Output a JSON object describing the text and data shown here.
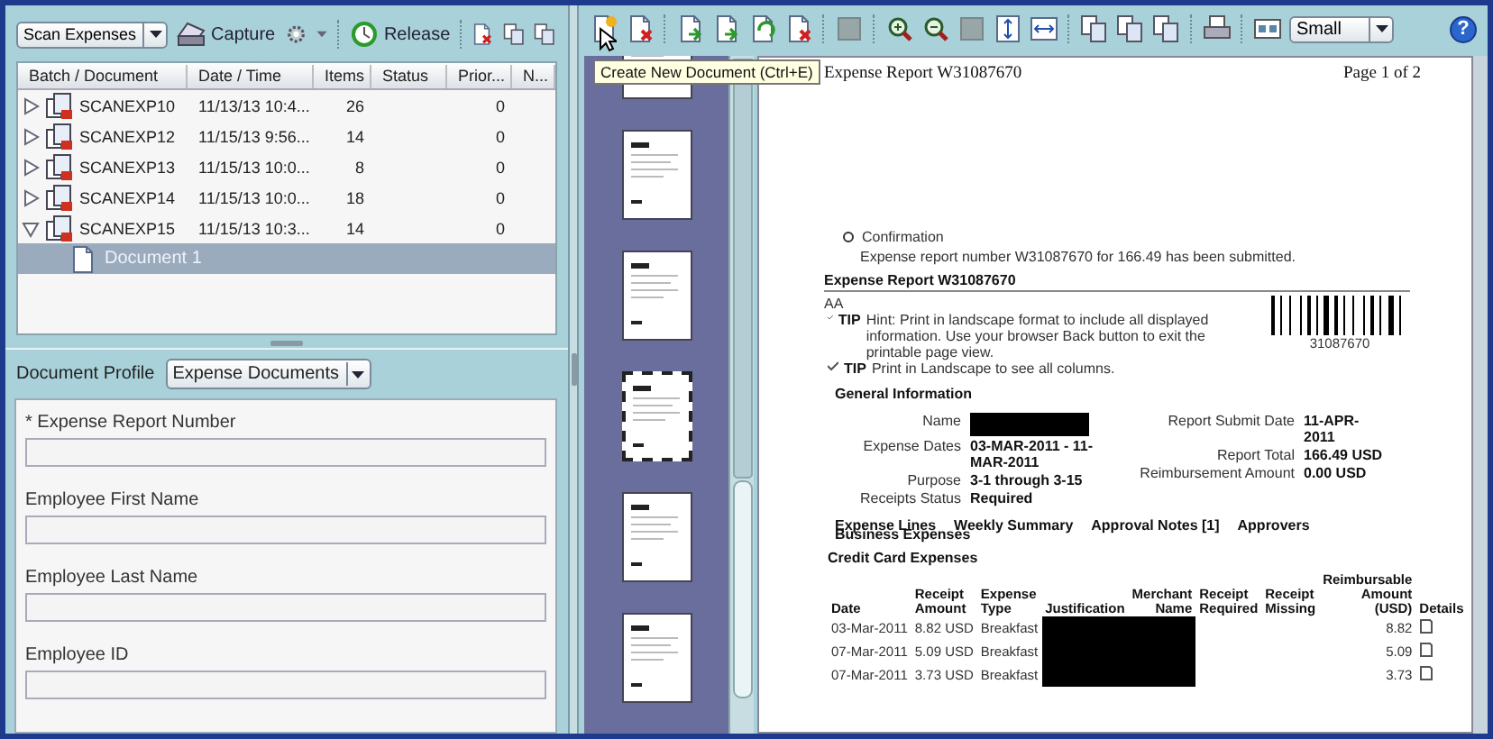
{
  "batch_toolbar": {
    "queue_select": "Scan Expenses",
    "capture_button": "Capture",
    "release_button": "Release"
  },
  "batch_table": {
    "columns": [
      "Batch / Document",
      "Date / Time",
      "Items",
      "Status",
      "Prior...",
      "N..."
    ],
    "rows": [
      {
        "name": "SCANEXP10",
        "date_time": "11/13/13 10:4...",
        "items": "26",
        "priority": "0",
        "expanded": false,
        "selected": false
      },
      {
        "name": "SCANEXP12",
        "date_time": "11/15/13 9:56...",
        "items": "14",
        "priority": "0",
        "expanded": false,
        "selected": false
      },
      {
        "name": "SCANEXP13",
        "date_time": "11/15/13 10:0...",
        "items": "8",
        "priority": "0",
        "expanded": false,
        "selected": false
      },
      {
        "name": "SCANEXP14",
        "date_time": "11/15/13 10:0...",
        "items": "18",
        "priority": "0",
        "expanded": false,
        "selected": false
      },
      {
        "name": "SCANEXP15",
        "date_time": "11/15/13 10:3...",
        "items": "14",
        "priority": "0",
        "expanded": true,
        "selected": false,
        "children": [
          {
            "name": "Document 1",
            "selected": true
          }
        ]
      }
    ]
  },
  "document_profile": {
    "label": "Document Profile",
    "value": "Expense Documents"
  },
  "index_fields": [
    {
      "label": "* Expense Report Number"
    },
    {
      "label": "Employee First Name"
    },
    {
      "label": "Employee Last Name"
    },
    {
      "label": "Employee ID"
    }
  ],
  "viewer_toolbar": {
    "zoom_select": "Small",
    "help_button": "?"
  },
  "tooltip": "Create New Document (Ctrl+E)",
  "thumbnails": [
    {
      "selected": false
    },
    {
      "selected": false
    },
    {
      "selected": false
    },
    {
      "selected": true
    },
    {
      "selected": false
    },
    {
      "selected": false
    }
  ],
  "page": {
    "header_title": "Expense Report W31087670",
    "page_number": "Page 1 of 2",
    "confirmation": {
      "title": "Confirmation",
      "message": "Expense report number W31087670 for 166.49 has been submitted."
    },
    "report_title": "Expense Report W31087670",
    "approver_code": "AA",
    "tips": [
      {
        "label": "TIP",
        "text": "Hint: Print in landscape format to include all displayed information. Use your browser Back button to exit the printable page view."
      },
      {
        "label": "TIP",
        "text": "Print in Landscape to see all columns."
      }
    ],
    "barcode_number": "31087670",
    "general_heading": "General Information",
    "info_left": [
      {
        "label": "Name",
        "redacted": true
      },
      {
        "label": "Expense Dates",
        "value": "03-MAR-2011 - 11-MAR-2011",
        "redacted": false
      },
      {
        "label": "Purpose",
        "value": "3-1 through 3-15",
        "redacted": false
      },
      {
        "label": "Receipts Status",
        "value": "Required",
        "redacted": false
      }
    ],
    "info_right": [
      {
        "label": "Report Submit Date",
        "value": "11-APR-2011"
      },
      {
        "label": "Report Total",
        "value": "166.49 USD"
      },
      {
        "label": "Reimbursement Amount",
        "value": "0.00 USD"
      }
    ],
    "tabs": [
      {
        "label": "Expense Lines"
      },
      {
        "label": "Weekly Summary"
      },
      {
        "label": "Approval Notes [1]"
      },
      {
        "label": "Approvers"
      }
    ],
    "section_title": "Business Expenses",
    "table_title": "Credit Card Expenses",
    "expense_columns": [
      "Date",
      "Receipt Amount",
      "Expense Type",
      "Justification",
      "Merchant Name",
      "Receipt Required",
      "Receipt Missing",
      "Reimbursable Amount (USD)",
      "Details"
    ],
    "expense_rows": [
      {
        "date": "03-Mar-2011",
        "receipt_amount": "8.82 USD",
        "expense_type": "Breakfast",
        "merchant_redacted": true,
        "reimbursable_amount": "8.82"
      },
      {
        "date": "07-Mar-2011",
        "receipt_amount": "5.09 USD",
        "expense_type": "Breakfast",
        "merchant_redacted": true,
        "reimbursable_amount": "5.09"
      },
      {
        "date": "07-Mar-2011",
        "receipt_amount": "3.73 USD",
        "expense_type": "Breakfast",
        "merchant_redacted": true,
        "reimbursable_amount": "3.73"
      }
    ]
  }
}
